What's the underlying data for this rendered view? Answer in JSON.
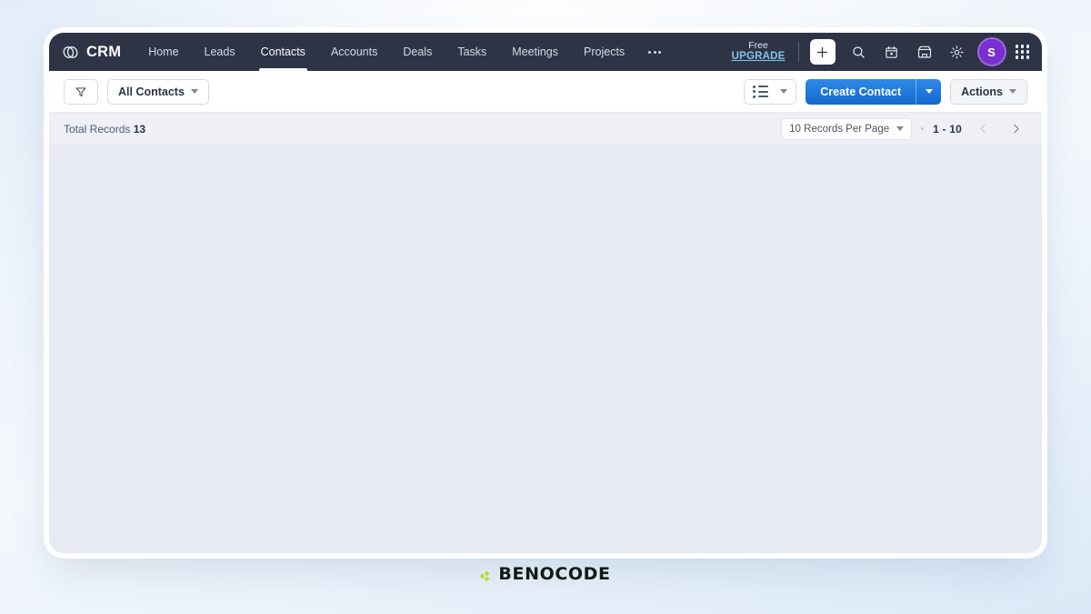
{
  "app": {
    "brand_name": "CRM",
    "brand_logo_icon": "interlocked-rings-icon"
  },
  "navbar": {
    "items": [
      {
        "label": "Home",
        "active": false
      },
      {
        "label": "Leads",
        "active": false
      },
      {
        "label": "Contacts",
        "active": true
      },
      {
        "label": "Accounts",
        "active": false
      },
      {
        "label": "Deals",
        "active": false
      },
      {
        "label": "Tasks",
        "active": false
      },
      {
        "label": "Meetings",
        "active": false
      },
      {
        "label": "Projects",
        "active": false
      }
    ],
    "more_icon": "ellipsis-icon",
    "plan": {
      "label": "Free",
      "upgrade_label": "UPGRADE",
      "upgrade_color": "#7fc4ee"
    },
    "actions": [
      {
        "icon": "plus-icon"
      },
      {
        "icon": "search-icon"
      },
      {
        "icon": "calendar-icon"
      },
      {
        "icon": "marketplace-icon"
      },
      {
        "icon": "gear-icon"
      }
    ],
    "avatar": {
      "initial": "S",
      "color": "#7a2fd0"
    },
    "apps_icon": "apps-grid-icon",
    "background_color": "#2e3446"
  },
  "toolbar": {
    "filter_icon": "filter-icon",
    "view_selector_label": "All Contacts",
    "view_mode_icon": "list-view-icon",
    "create_label": "Create Contact",
    "create_color": "#1169cf",
    "actions_label": "Actions"
  },
  "records": {
    "total_label": "Total Records",
    "total_count": "13",
    "per_page_label": "10 Records Per Page",
    "range_label": "1 - 10",
    "prev_icon": "chevron-left-icon",
    "next_icon": "chevron-right-icon",
    "prev_disabled": true
  },
  "footer": {
    "logo_text": "BENOCODE",
    "logo_dot_color": "#b6e02a",
    "logo_text_color": "#0f1a14"
  }
}
